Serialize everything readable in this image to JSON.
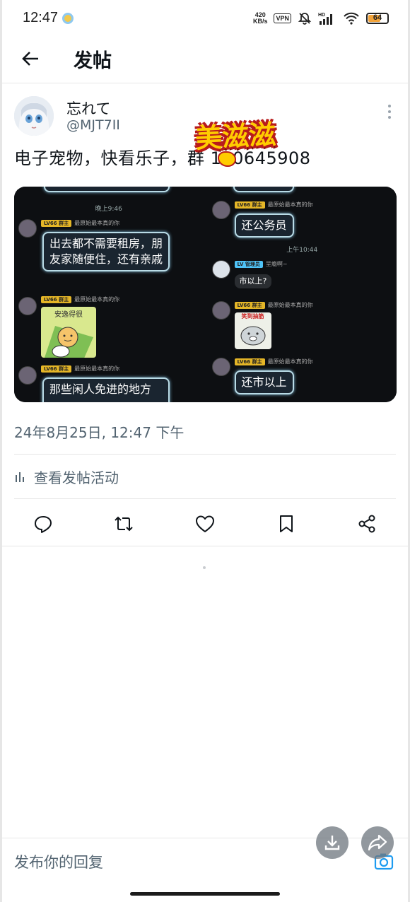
{
  "status_bar": {
    "time": "12:47",
    "net_speed_value": "420",
    "net_speed_unit": "KB/s",
    "vpn": "VPN",
    "battery": "64",
    "battery_level": 0.64,
    "icons": [
      "location-badge-icon",
      "bell-off-icon",
      "hd-signal-icon",
      "wifi-icon",
      "battery-icon"
    ]
  },
  "header": {
    "title": "发帖",
    "back_icon": "arrow-left-icon"
  },
  "post": {
    "author_name": "忘れて",
    "author_handle": "@MJT7II",
    "text": "电子宠物，快看乐子，群 140645908",
    "sticker_text": "美滋滋",
    "timestamp": "24年8月25日, 12:47 下午",
    "activity_label": "查看发帖活动"
  },
  "media": {
    "left": {
      "time": "晚上9:46",
      "msg1_sender": "最原始最本真的你",
      "msg1_level": "LV66 群主",
      "msg1_text": "出去都不需要租房，朋友家随便住，还有亲戚",
      "msg2_sender": "最原始最本真的你",
      "msg2_level": "LV66 群主",
      "msg2_sticker_text": "安逸得很",
      "msg3_sender": "最原始最本真的你",
      "msg3_level": "LV66 群主",
      "msg3_text": "那些闲人免进的地方"
    },
    "right": {
      "msg1_sender": "最原始最本真的你",
      "msg1_level": "LV66 群主",
      "msg1_text": "还公务员",
      "time": "上午10:44",
      "msg2_sender": "呈瘾啊~",
      "msg2_level": "LV 管理员",
      "msg2_text": "市以上?",
      "msg3_sender": "最原始最本真的你",
      "msg3_level": "LV66 群主",
      "msg3_sticker_text": "笑到抽筋",
      "msg4_sender": "最原始最本真的你",
      "msg4_level": "LV66 群主",
      "msg4_text": "还市以上"
    }
  },
  "actions": [
    "reply-icon",
    "retweet-icon",
    "like-icon",
    "bookmark-icon",
    "share-icon"
  ],
  "reply": {
    "placeholder": "发布你的回复"
  },
  "floating": [
    "download-icon",
    "forward-icon"
  ],
  "colors": {
    "text_primary": "#0f1419",
    "text_secondary": "#536471",
    "accent": "#1d9bf0",
    "divider": "#e6e6e6"
  }
}
